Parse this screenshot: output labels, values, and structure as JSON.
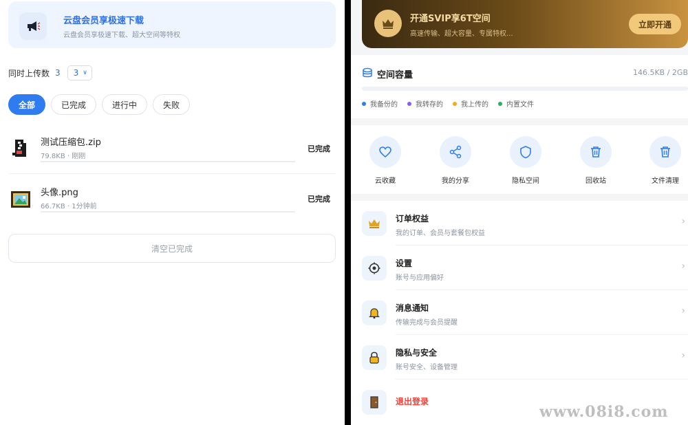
{
  "left": {
    "promo": {
      "title": "云盘会员享极速下载",
      "subtitle": "云盘会员享极速下载、超大空间等特权",
      "icon": "megaphone-icon"
    },
    "concurrency": {
      "label": "同时上传数",
      "current": "3",
      "selected": "3"
    },
    "filters": [
      {
        "label": "全部",
        "active": true
      },
      {
        "label": "已完成",
        "active": false
      },
      {
        "label": "进行中",
        "active": false
      },
      {
        "label": "失败",
        "active": false
      }
    ],
    "files": [
      {
        "name": "测试压缩包.zip",
        "meta": "79.8KB · 刚刚",
        "status": "已完成",
        "icon": "zip-file-icon",
        "progress": 1.0
      },
      {
        "name": "头像.png",
        "meta": "66.7KB · 1分钟前",
        "status": "已完成",
        "icon": "image-file-icon",
        "progress": 1.0
      }
    ],
    "clear_label": "清空已完成"
  },
  "right": {
    "vip": {
      "title": "开通SVIP享6T空间",
      "subtitle": "高速传输、超大容量、专属特权...",
      "button": "立即开通",
      "icon": "crown-icon"
    },
    "storage": {
      "title": "空间容量",
      "value": "146.5KB / 2GB",
      "used_fraction": 0.0001,
      "legend": [
        {
          "label": "我备份的",
          "color": "#2f7cf0"
        },
        {
          "label": "我转存的",
          "color": "#8a5cf6"
        },
        {
          "label": "我上传的",
          "color": "#f5a623"
        },
        {
          "label": "内置文件",
          "color": "#22b35e"
        }
      ]
    },
    "quick_actions": [
      {
        "label": "云收藏",
        "icon": "heart-icon"
      },
      {
        "label": "我的分享",
        "icon": "share-icon"
      },
      {
        "label": "隐私空间",
        "icon": "shield-icon"
      },
      {
        "label": "回收站",
        "icon": "trash-icon"
      },
      {
        "label": "文件清理",
        "icon": "trash-icon"
      }
    ],
    "menu": [
      {
        "title": "订单权益",
        "subtitle": "我的订单、会员与套餐包权益",
        "icon": "crown-icon"
      },
      {
        "title": "设置",
        "subtitle": "账号与应用偏好",
        "icon": "gear-icon"
      },
      {
        "title": "消息通知",
        "subtitle": "传输完成与会员提醒",
        "icon": "bell-icon"
      },
      {
        "title": "隐私与安全",
        "subtitle": "账号安全、设备管理",
        "icon": "lock-icon"
      }
    ],
    "logout": {
      "title": "退出登录",
      "icon": "door-icon"
    }
  },
  "watermark": "www.08i8.com"
}
